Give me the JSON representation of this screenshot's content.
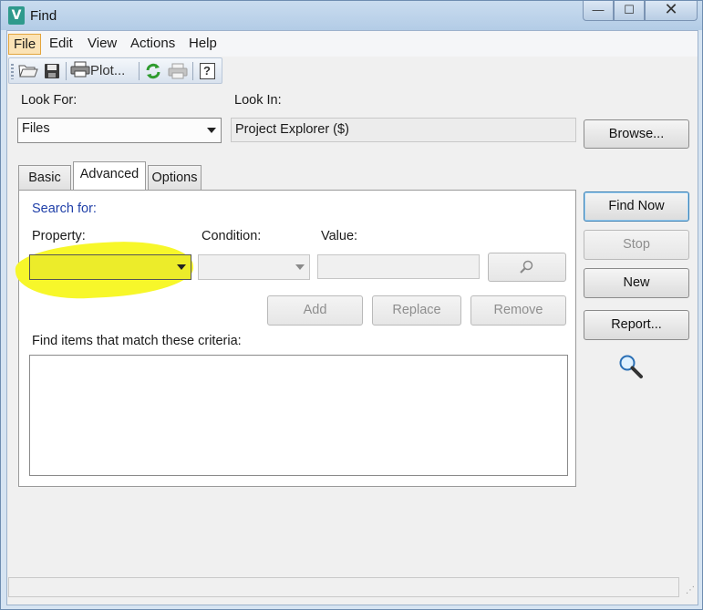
{
  "window": {
    "title": "Find",
    "app_icon_letter": "V",
    "controls": {
      "minimize": "—",
      "maximize": "☐",
      "close": "✕"
    }
  },
  "menubar": {
    "items": [
      "File",
      "Edit",
      "View",
      "Actions",
      "Help"
    ],
    "active_item": "File"
  },
  "toolbar": {
    "buttons": [
      {
        "icon": "open-folder-icon"
      },
      {
        "icon": "save-icon"
      },
      {
        "icon": "printer-icon",
        "label": "Plot..."
      },
      {
        "icon": "refresh-icon"
      },
      {
        "icon": "print-disabled-icon"
      },
      {
        "icon": "help-icon",
        "glyph": "?"
      }
    ]
  },
  "look_for": {
    "label": "Look For:",
    "value": "Files"
  },
  "look_in": {
    "label": "Look In:",
    "value": "Project Explorer ($)"
  },
  "buttons": {
    "browse": "Browse...",
    "find_now": "Find Now",
    "stop": "Stop",
    "new": "New",
    "report": "Report...",
    "add": "Add",
    "replace": "Replace",
    "remove": "Remove"
  },
  "tabs": [
    {
      "label": "Basic",
      "selected": false
    },
    {
      "label": "Advanced",
      "selected": true
    },
    {
      "label": "Options",
      "selected": false
    }
  ],
  "advanced": {
    "search_for": "Search for:",
    "property_label": "Property:",
    "condition_label": "Condition:",
    "value_label": "Value:",
    "property_value": "",
    "condition_value": "",
    "value_value": "",
    "criteria_label": "Find items that match these criteria:"
  },
  "colors": {
    "highlight": "#f7f72a",
    "search_for_text": "#1f3fa8",
    "menu_active_bg": "#fbe3b6"
  }
}
